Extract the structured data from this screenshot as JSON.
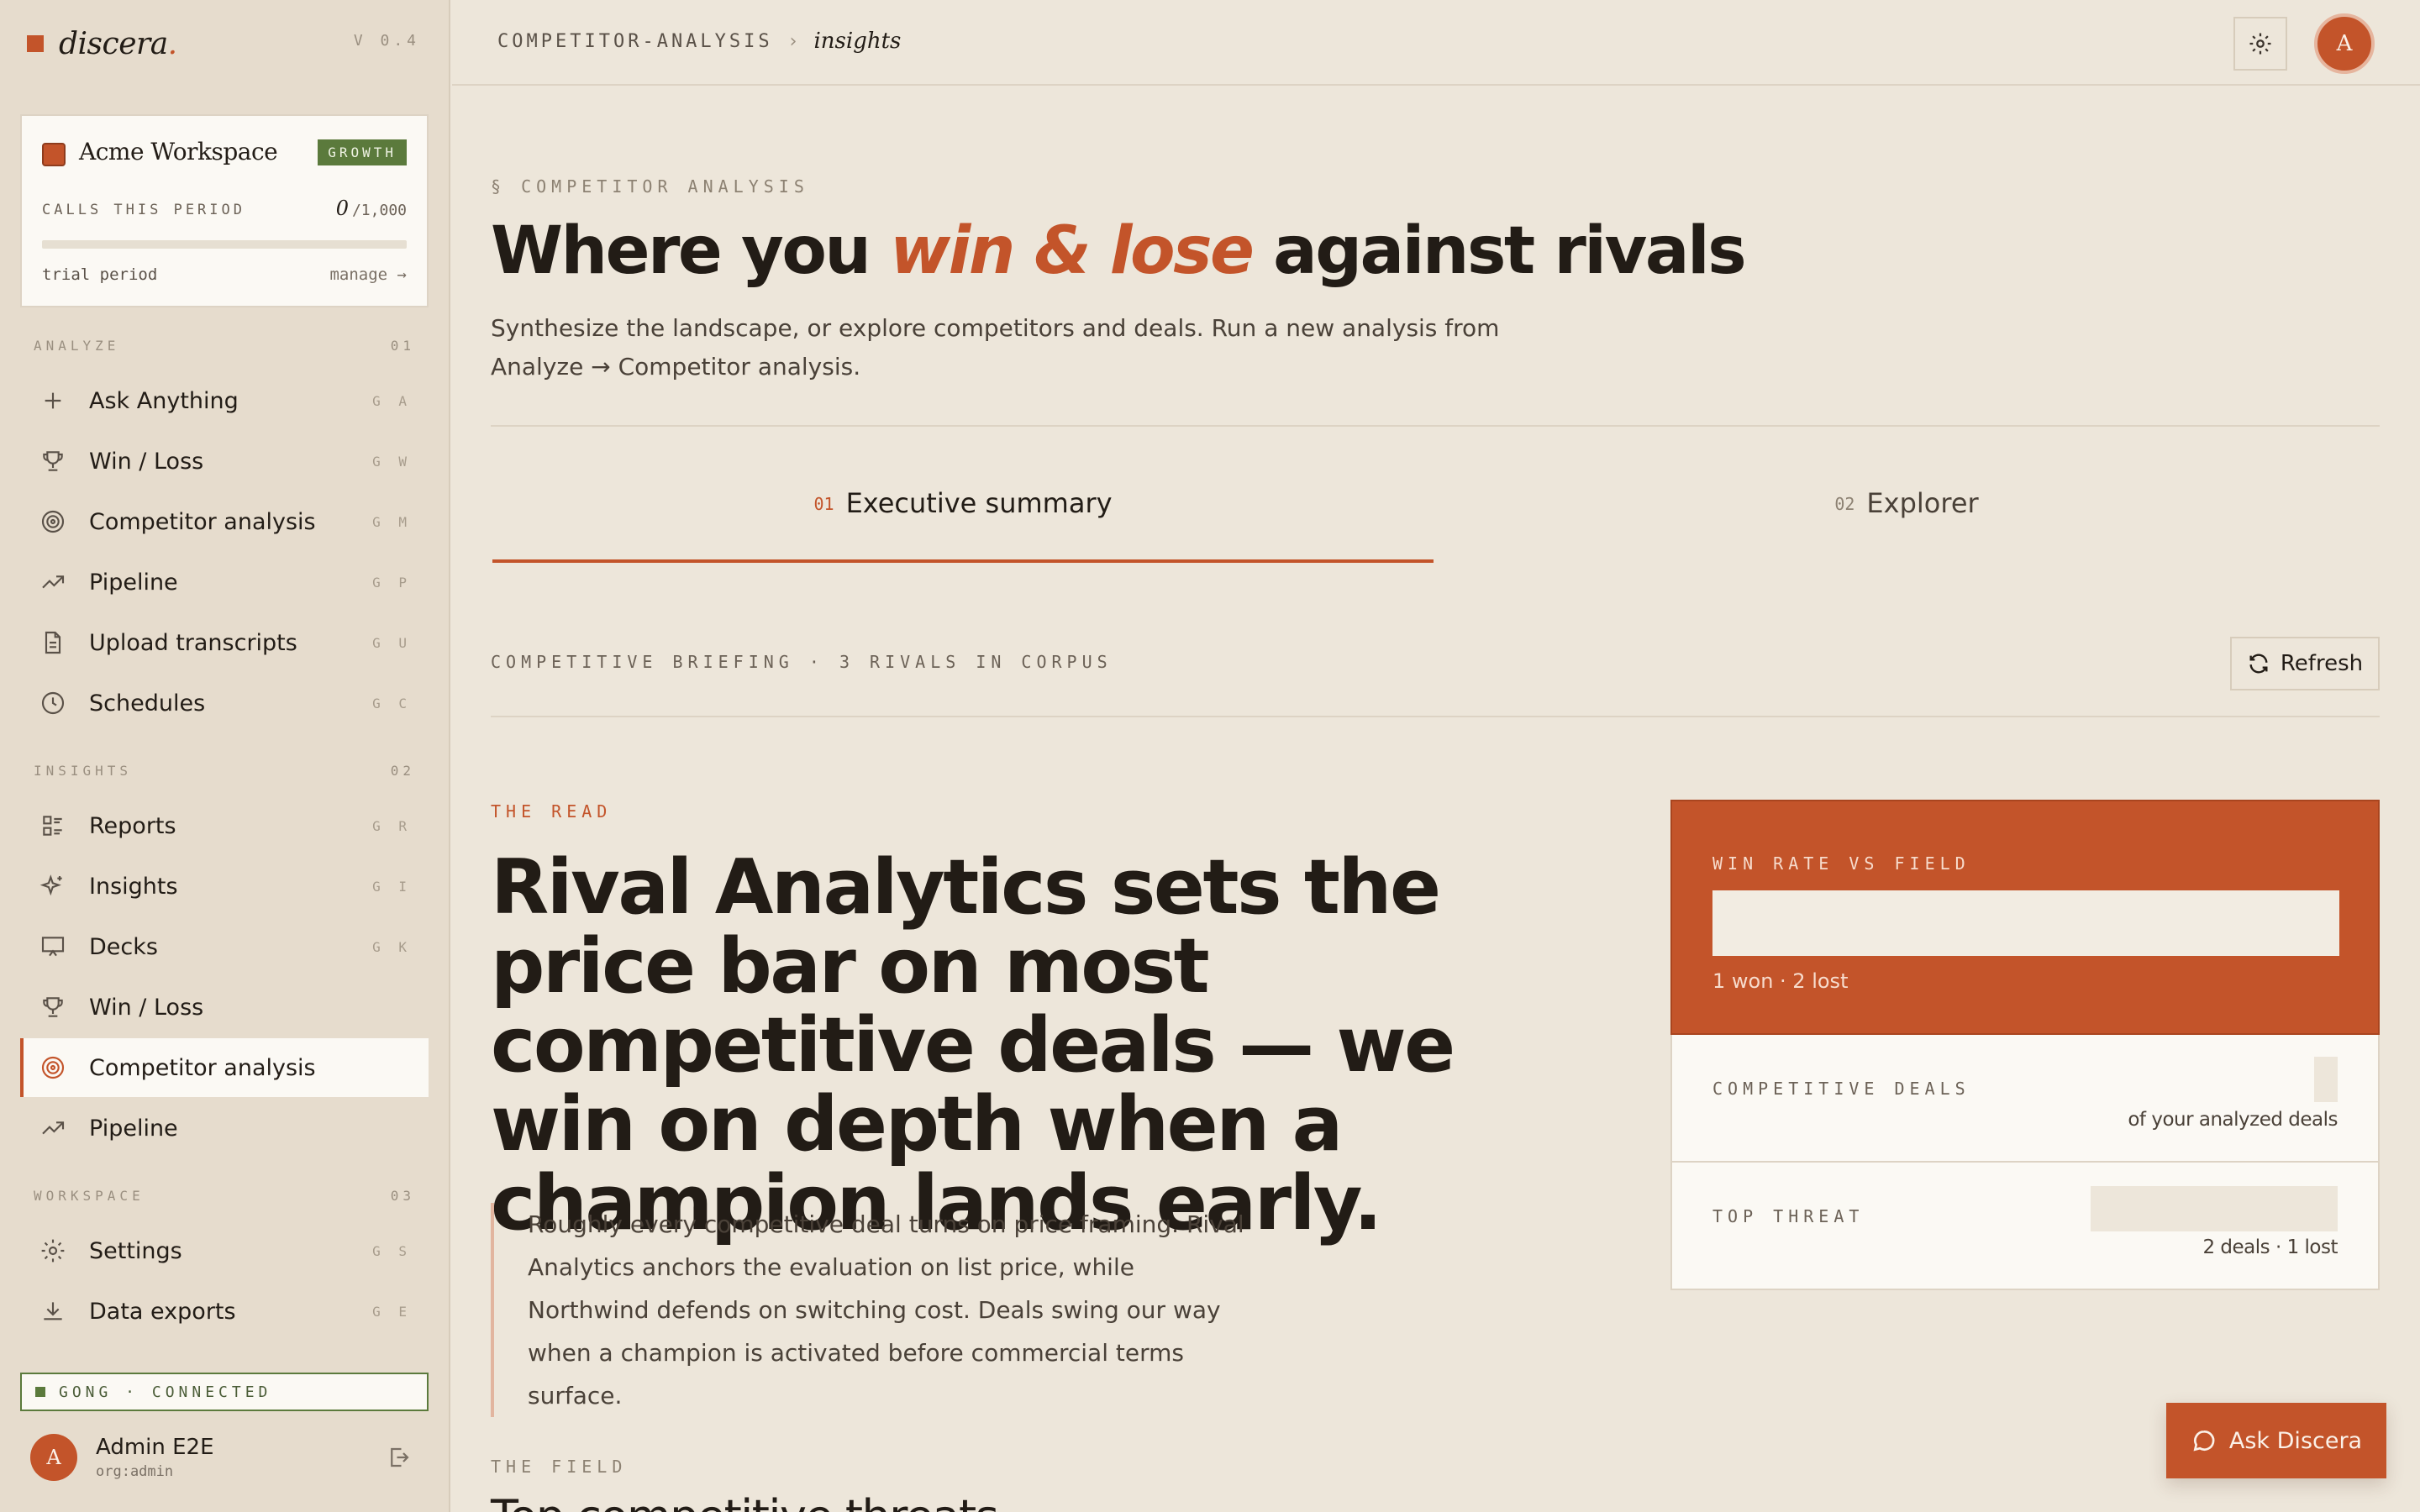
{
  "brand": {
    "name": "discera",
    "dot": ".",
    "version": "V 0.4"
  },
  "workspace": {
    "name": "Acme Workspace",
    "plan": "GROWTH",
    "calls_label": "CALLS THIS PERIOD",
    "calls_used": "0",
    "calls_limit": "/1,000",
    "calls_fraction": 0,
    "trial": "trial period",
    "manage": "manage →"
  },
  "nav": {
    "analyze": {
      "title": "ANALYZE",
      "num": "01",
      "items": [
        {
          "label": "Ask Anything",
          "kbd": "G A",
          "icon": "plus-icon"
        },
        {
          "label": "Win / Loss",
          "kbd": "G W",
          "icon": "trophy-icon"
        },
        {
          "label": "Competitor analysis",
          "kbd": "G M",
          "icon": "target-icon"
        },
        {
          "label": "Pipeline",
          "kbd": "G P",
          "icon": "trend-icon"
        },
        {
          "label": "Upload transcripts",
          "kbd": "G U",
          "icon": "document-icon"
        },
        {
          "label": "Schedules",
          "kbd": "G C",
          "icon": "clock-icon"
        }
      ]
    },
    "insights": {
      "title": "INSIGHTS",
      "num": "02",
      "items": [
        {
          "label": "Reports",
          "kbd": "G R",
          "icon": "list-icon"
        },
        {
          "label": "Insights",
          "kbd": "G I",
          "icon": "sparkle-icon"
        },
        {
          "label": "Decks",
          "kbd": "G K",
          "icon": "presentation-icon"
        },
        {
          "label": "Win / Loss",
          "kbd": "",
          "icon": "trophy-icon"
        },
        {
          "label": "Competitor analysis",
          "kbd": "",
          "icon": "target-icon",
          "active": true
        },
        {
          "label": "Pipeline",
          "kbd": "",
          "icon": "trend-icon"
        }
      ]
    },
    "workspace": {
      "title": "WORKSPACE",
      "num": "03",
      "items": [
        {
          "label": "Settings",
          "kbd": "G S",
          "icon": "gear-icon"
        },
        {
          "label": "Data exports",
          "kbd": "G E",
          "icon": "download-icon"
        }
      ]
    }
  },
  "integration": {
    "status": "GONG · CONNECTED"
  },
  "user": {
    "initial": "A",
    "name": "Admin E2E",
    "org": "org:admin"
  },
  "topbar": {
    "crumb_1": "COMPETITOR-ANALYSIS",
    "crumb_sep": "›",
    "crumb_2": "insights",
    "avatar_initial": "A"
  },
  "page": {
    "eyebrow": "§ COMPETITOR ANALYSIS",
    "headline_pre": "Where you ",
    "headline_accent": "win & lose",
    "headline_post": " against rivals",
    "subtitle": "Synthesize the landscape, or explore competitors and deals. Run a new analysis from Analyze → Competitor analysis."
  },
  "tabs": [
    {
      "num": "01",
      "label": "Executive summary",
      "active": true
    },
    {
      "num": "02",
      "label": "Explorer",
      "active": false
    }
  ],
  "briefing": {
    "label": "COMPETITIVE BRIEFING · 3 RIVALS IN CORPUS",
    "refresh": "Refresh"
  },
  "read": {
    "eyebrow": "THE READ",
    "headline": "Rival Analytics sets the price bar on most competitive deals — we win on depth when a champion lands early.",
    "quote": "Roughly every competitive deal turns on price framing. Rival Analytics anchors the evaluation on list price, while Northwind defends on switching cost. Deals swing our way when a champion is activated before commercial terms surface."
  },
  "stats": {
    "win_rate": {
      "label": "WIN RATE VS FIELD",
      "sub": "1 won · 2 lost"
    },
    "competitive_deals": {
      "label": "COMPETITIVE DEALS",
      "sub": "of your analyzed deals"
    },
    "top_threat": {
      "label": "TOP THREAT",
      "sub": "2 deals · 1 lost"
    }
  },
  "field": {
    "eyebrow": "THE FIELD",
    "title": "Top competitive threats"
  },
  "ask": {
    "label": "Ask Discera"
  },
  "colors": {
    "accent": "#c3542a",
    "success": "#5b7a3c",
    "background": "#ede6da",
    "sidebar": "#e6dccd"
  }
}
